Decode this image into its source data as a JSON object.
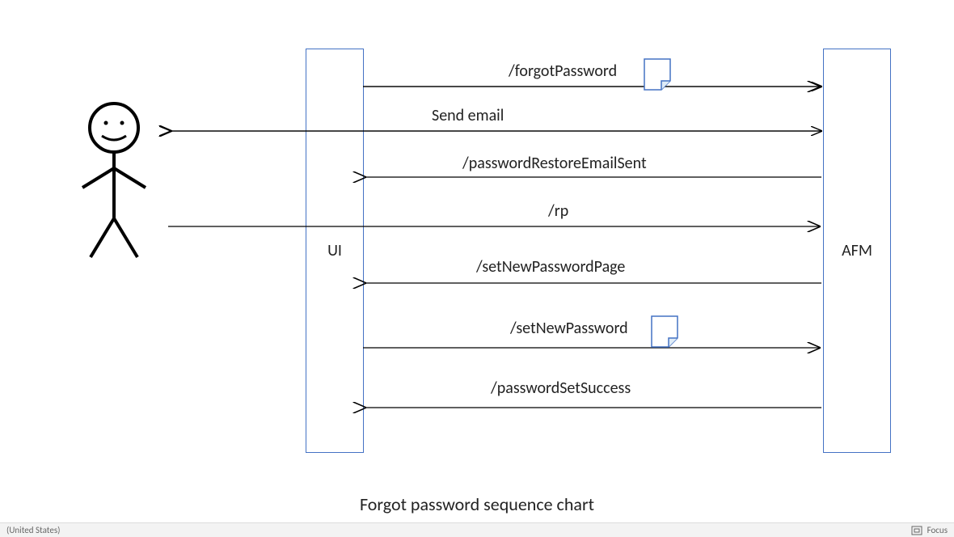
{
  "chart_data": {
    "type": "sequence",
    "title": "Forgot password sequence chart",
    "participants": [
      {
        "id": "user",
        "label": "User",
        "kind": "actor"
      },
      {
        "id": "ui",
        "label": "UI",
        "kind": "lifeline"
      },
      {
        "id": "afm",
        "label": "AFM",
        "kind": "lifeline"
      }
    ],
    "messages": [
      {
        "from": "ui",
        "to": "afm",
        "label": "/forgotPassword",
        "note": true
      },
      {
        "from": "afm",
        "to": "user",
        "label": "Send email"
      },
      {
        "from": "afm",
        "to": "ui",
        "label": "/passwordRestoreEmailSent"
      },
      {
        "from": "user",
        "to": "afm",
        "label": "/rp"
      },
      {
        "from": "afm",
        "to": "ui",
        "label": "/setNewPasswordPage"
      },
      {
        "from": "ui",
        "to": "afm",
        "label": "/setNewPassword",
        "note": true
      },
      {
        "from": "afm",
        "to": "ui",
        "label": "/passwordSetSuccess"
      }
    ]
  },
  "lifelines": {
    "ui_label": "UI",
    "afm_label": "AFM"
  },
  "messages": {
    "m1": "/forgotPassword",
    "m2": "Send email",
    "m3": "/passwordRestoreEmailSent",
    "m4": "/rp",
    "m5": "/setNewPasswordPage",
    "m6": "/setNewPassword",
    "m7": "/passwordSetSuccess"
  },
  "caption": "Forgot password sequence chart",
  "statusbar": {
    "left": "(United States)",
    "focus": "Focus"
  }
}
